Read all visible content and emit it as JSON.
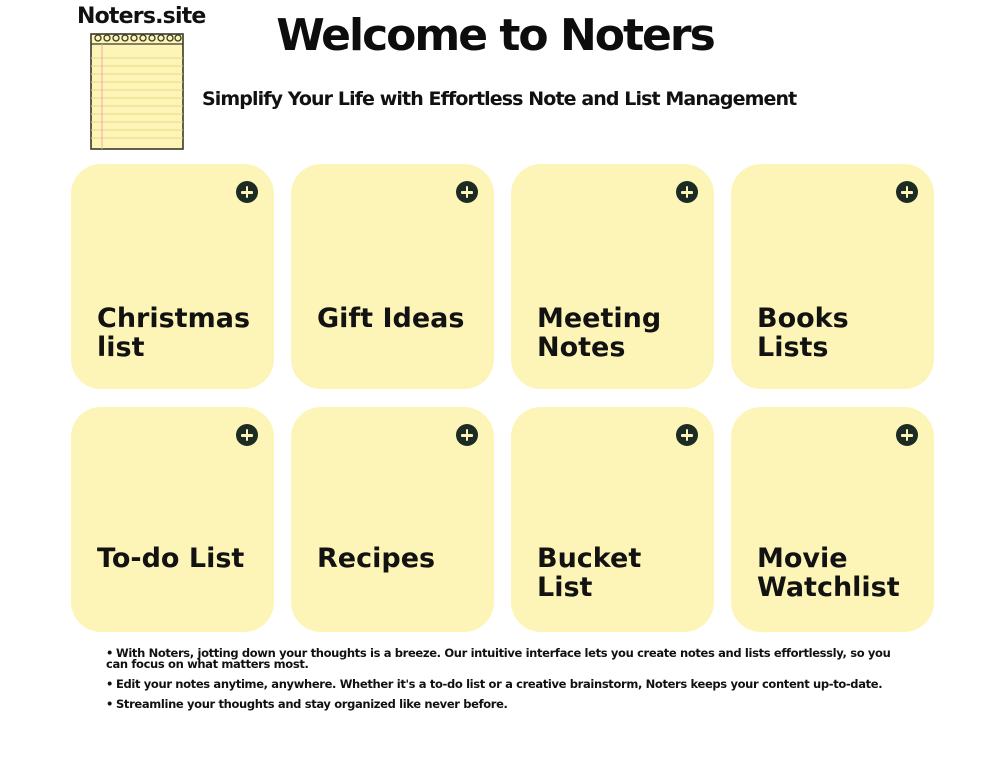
{
  "header": {
    "site_name": "Noters.site",
    "title": "Welcome to Noters",
    "subtitle": "Simplify Your Life with Effortless Note and List Management"
  },
  "logo": {
    "icon": "notepad-icon",
    "paper_color": "#fdf5b7",
    "line_color": "#e9d98a",
    "margin_color": "#f2a7a0"
  },
  "cards": [
    {
      "label": "Christmas\nlist",
      "add_icon": "plus-circle-icon"
    },
    {
      "label": "Gift Ideas",
      "add_icon": "plus-circle-icon"
    },
    {
      "label": "Meeting\nNotes",
      "add_icon": "plus-circle-icon"
    },
    {
      "label": "Books\nLists",
      "add_icon": "plus-circle-icon"
    },
    {
      "label": "To-do List",
      "add_icon": "plus-circle-icon"
    },
    {
      "label": "Recipes",
      "add_icon": "plus-circle-icon"
    },
    {
      "label": "Bucket\nList",
      "add_icon": "plus-circle-icon"
    },
    {
      "label": "Movie\nWatchlist",
      "add_icon": "plus-circle-icon"
    }
  ],
  "bullets": [
    "With Noters, jotting down your thoughts is a breeze. Our intuitive interface lets you create notes and lists effortlessly, so you can focus on what matters most.",
    "Edit your notes anytime, anywhere. Whether it's a to-do list or a creative brainstorm, Noters keeps your content up-to-date.",
    "Streamline your thoughts and stay organized like never before."
  ],
  "colors": {
    "card_background": "#fdf5b7",
    "add_button": "#1c2b24",
    "text": "#111111"
  }
}
